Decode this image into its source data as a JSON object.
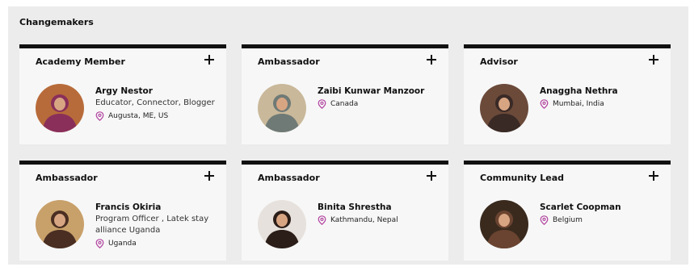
{
  "section": {
    "title": "Changemakers"
  },
  "colors": {
    "card_bar": "#111111",
    "pin": "#b0409e",
    "background": "#ececec"
  },
  "cards": [
    {
      "role": "Academy Member",
      "name": "Argy Nestor",
      "description": "Educator, Connector, Blogger",
      "location": "Augusta, ME, US",
      "avatar_tone": "#8a2f5a",
      "avatar_bg": "#b86b3a"
    },
    {
      "role": "Ambassador",
      "name": "Zaibi Kunwar Manzoor",
      "description": "",
      "location": "Canada",
      "avatar_tone": "#6f7a76",
      "avatar_bg": "#c9b89a"
    },
    {
      "role": "Advisor",
      "name": "Anaggha Nethra",
      "description": "",
      "location": "Mumbai, India",
      "avatar_tone": "#3a2a26",
      "avatar_bg": "#6b4a3a"
    },
    {
      "role": "Ambassador",
      "name": "Francis Okiria",
      "description": "Program Officer , Latek stay alliance Uganda",
      "location": "Uganda",
      "avatar_tone": "#4a2e22",
      "avatar_bg": "#c8a06a"
    },
    {
      "role": "Ambassador",
      "name": "Binita Shrestha",
      "description": "",
      "location": "Kathmandu, Nepal",
      "avatar_tone": "#2b1d18",
      "avatar_bg": "#e6e1dc"
    },
    {
      "role": "Community Lead",
      "name": "Scarlet Coopman",
      "description": "",
      "location": "Belgium",
      "avatar_tone": "#6a4430",
      "avatar_bg": "#3a2a1e"
    }
  ]
}
